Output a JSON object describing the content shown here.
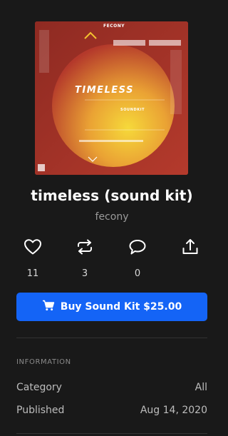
{
  "product": {
    "title": "timeless (sound kit)",
    "artist": "fecony"
  },
  "cover": {
    "brand": "FECONY",
    "headline": "TIMELESS",
    "subline": "SOUNDKIT",
    "colors": {
      "background": "#a8352a",
      "sun_inner": "#f2cc3a",
      "sun_outer": "#c4482a"
    }
  },
  "actions": [
    {
      "icon": "heart-icon",
      "count": "11"
    },
    {
      "icon": "repost-icon",
      "count": "3"
    },
    {
      "icon": "comment-icon",
      "count": "0"
    },
    {
      "icon": "share-icon"
    }
  ],
  "buy_button": {
    "label": "Buy Sound Kit $25.00",
    "icon": "cart-icon",
    "color": "#1464f6"
  },
  "information": {
    "heading": "INFORMATION",
    "rows": [
      {
        "label": "Category",
        "value": "All"
      },
      {
        "label": "Published",
        "value": "Aug 14, 2020"
      }
    ]
  }
}
